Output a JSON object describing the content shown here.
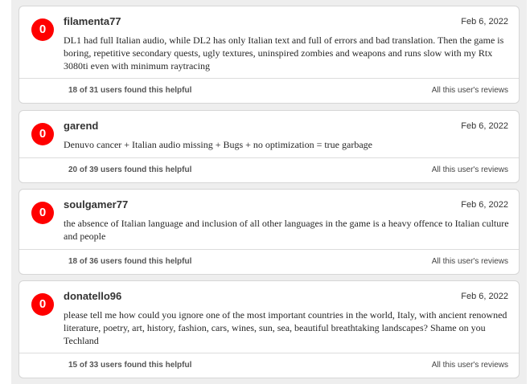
{
  "reviews": [
    {
      "score": "0",
      "username": "filamenta77",
      "date": "Feb 6, 2022",
      "text": "DL1 had full Italian audio, while DL2 has only Italian text and full of errors and bad translation. Then the game is boring, repetitive secondary quests, ugly textures, uninspired zombies and weapons and runs slow with my Rtx 3080ti even with minimum raytracing",
      "helpful": "18 of 31 users found this helpful",
      "all_reviews_link": "All this user's reviews"
    },
    {
      "score": "0",
      "username": "garend",
      "date": "Feb 6, 2022",
      "text": "Denuvo cancer + Italian audio missing + Bugs + no optimization = true garbage",
      "helpful": "20 of 39 users found this helpful",
      "all_reviews_link": "All this user's reviews"
    },
    {
      "score": "0",
      "username": "soulgamer77",
      "date": "Feb 6, 2022",
      "text": "the absence of Italian language and inclusion of all other languages in the game is a heavy offence to Italian culture and people",
      "helpful": "18 of 36 users found this helpful",
      "all_reviews_link": "All this user's reviews"
    },
    {
      "score": "0",
      "username": "donatello96",
      "date": "Feb 6, 2022",
      "text": "please tell me how could you ignore one of the most important countries in the world, Italy, with ancient renowned literature, poetry, art, history, fashion, cars, wines, sun, sea, beautiful breathtaking landscapes? Shame on you Techland",
      "helpful": "15 of 33 users found this helpful",
      "all_reviews_link": "All this user's reviews"
    }
  ],
  "colors": {
    "score_badge": "#ff0000",
    "card_border": "#d6d6d6",
    "background_rail": "#eeeeee"
  }
}
